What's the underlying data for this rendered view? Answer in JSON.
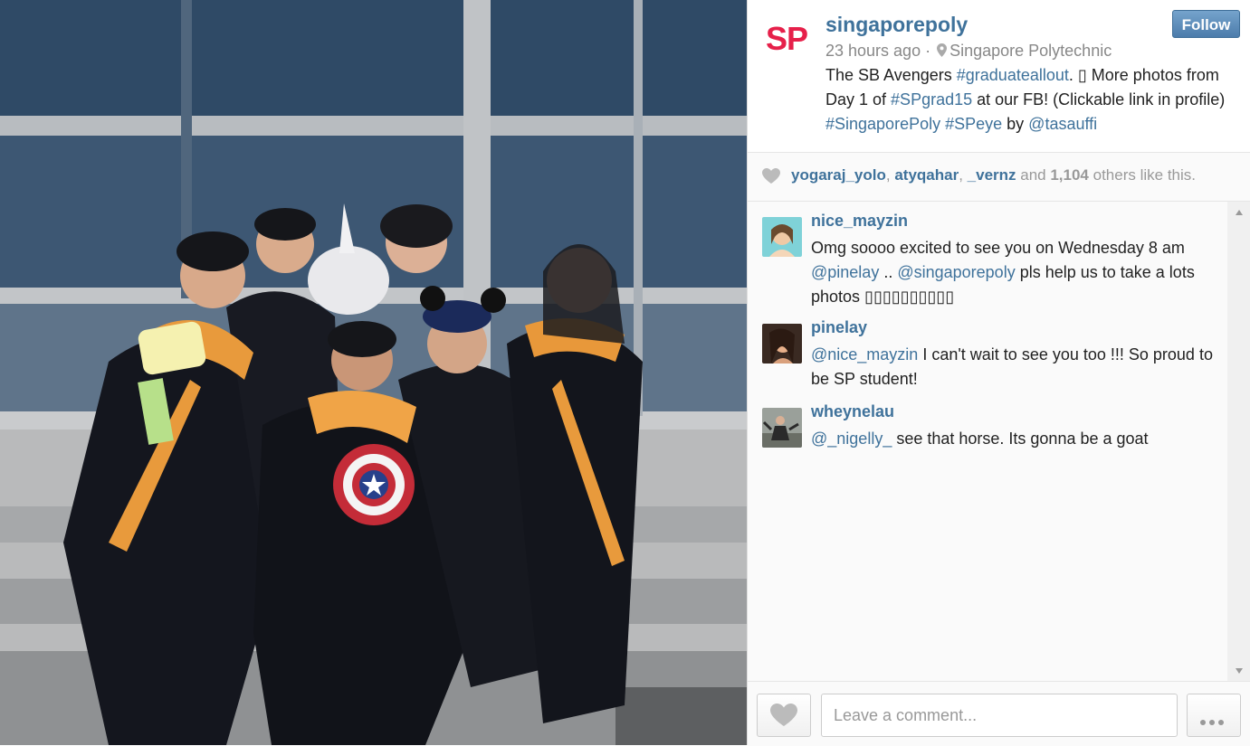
{
  "post": {
    "username": "singaporepoly",
    "logo_text": "SP",
    "time": "23 hours ago",
    "separator": " · ",
    "location": "Singapore Polytechnic",
    "follow_label": "Follow",
    "caption": {
      "t1": "The SB Avengers ",
      "tag1": "#graduateallout",
      "t2": ". ▯ More photos from Day 1 of ",
      "tag2": "#SPgrad15",
      "t3": " at our FB! (Clickable link in profile) ",
      "tag3": "#SingaporePoly",
      "t4": " ",
      "tag4": "#SPeye",
      "t5": " by ",
      "tag5": "@tasauffi"
    },
    "photo_alt": "Graduates in gowns posing with a unicorn mask, Captain America shield and mouse ears hat"
  },
  "likes": {
    "user1": "yogaraj_yolo",
    "sep1": ", ",
    "user2": "atyqahar",
    "sep2": ", ",
    "user3": "_vernz",
    "and": " and ",
    "count": "1,104",
    "suffix": " others like this."
  },
  "comments": [
    {
      "user": "nice_mayzin",
      "t1": "Omg soooo excited to see you on Wednesday 8 am ",
      "m1": "@pinelay",
      "t2": " .. ",
      "m2": "@singaporepoly",
      "t3": " pls help us to take a lots photos ▯▯▯▯▯▯▯▯▯▯"
    },
    {
      "user": "pinelay",
      "m1": "@nice_mayzin",
      "t1": " I can't wait to see you too !!! So proud to be SP student!"
    },
    {
      "user": "wheynelau",
      "m1": "@_nigelly_",
      "t1": " see that horse. Its gonna be a goat"
    }
  ],
  "composer": {
    "placeholder": "Leave a comment..."
  },
  "colors": {
    "link": "#3f729b",
    "brand": "#e6204a"
  }
}
